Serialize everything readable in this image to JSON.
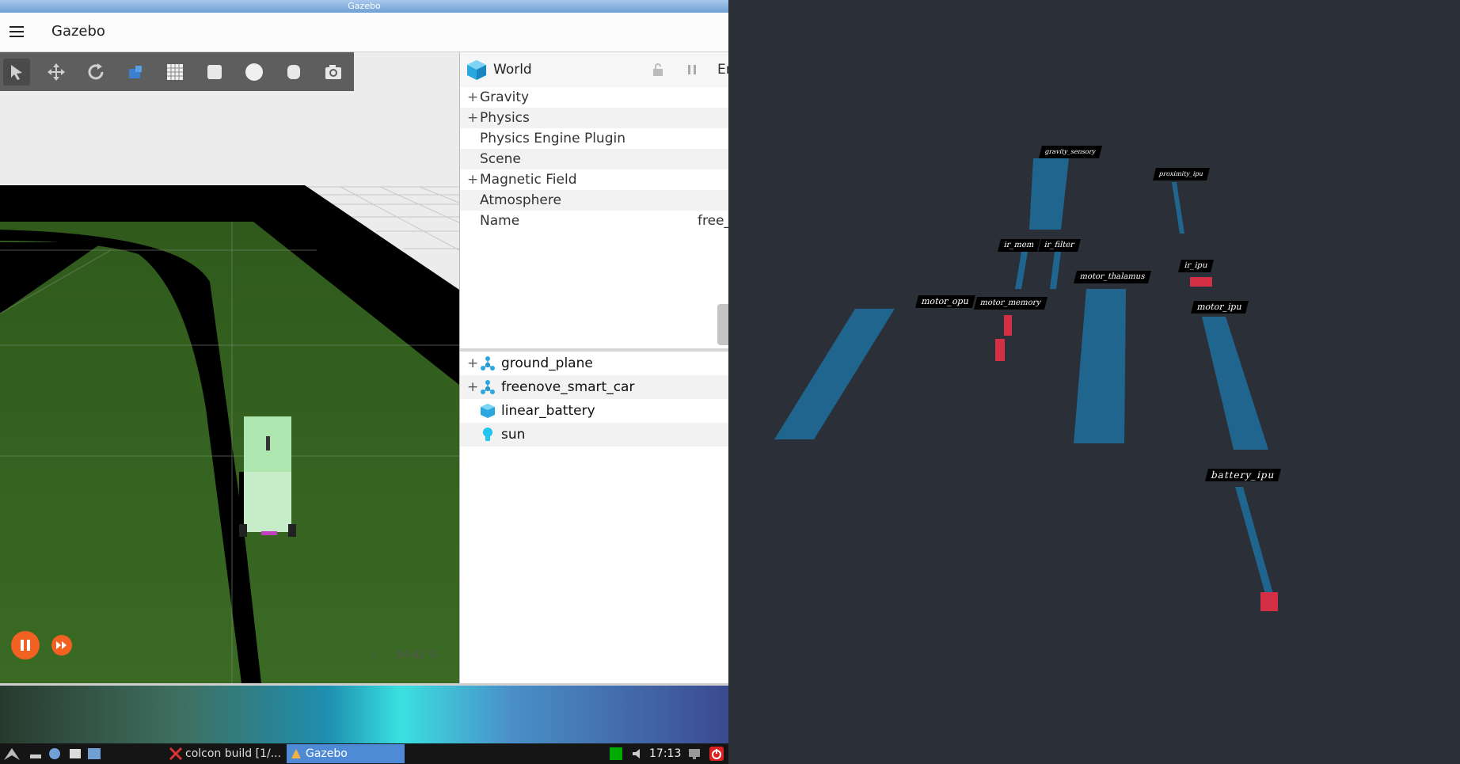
{
  "window": {
    "title": "Gazebo"
  },
  "appbar": {
    "title": "Gazebo"
  },
  "toolbar": {
    "tools": [
      "select-icon",
      "translate-icon",
      "rotate-icon",
      "scale-icon",
      "grid-icon",
      "box-icon",
      "sphere-icon",
      "cylinder-icon",
      "camera-icon"
    ]
  },
  "world_panel": {
    "title": "World",
    "header_extra": "Er",
    "properties": [
      {
        "label": "Gravity",
        "expandable": true
      },
      {
        "label": "Physics",
        "expandable": true
      },
      {
        "label": "Physics Engine Plugin",
        "expandable": false
      },
      {
        "label": "Scene",
        "expandable": false
      },
      {
        "label": "Magnetic Field",
        "expandable": true
      },
      {
        "label": "Atmosphere",
        "expandable": false
      },
      {
        "label": "Name",
        "expandable": false,
        "value": "free_"
      }
    ],
    "models": [
      {
        "label": "ground_plane",
        "expandable": true,
        "icon": "model-icon"
      },
      {
        "label": "freenove_smart_car",
        "expandable": true,
        "icon": "model-icon"
      },
      {
        "label": "linear_battery",
        "expandable": false,
        "icon": "cube-icon"
      },
      {
        "label": "sun",
        "expandable": false,
        "icon": "light-icon"
      }
    ]
  },
  "sim_controls": {
    "real_time_factor": "54.62 %"
  },
  "taskbar": {
    "items": [
      "colcon build [1/...",
      "Gazebo"
    ],
    "clock": "17:13"
  },
  "visualization": {
    "labels": [
      "gravity_sensory",
      "proximity_ipu",
      "ir_mem",
      "ir_filter",
      "motor_thalamus",
      "ir_ipu",
      "motor_opu",
      "motor_memory",
      "motor_ipu",
      "battery_ipu"
    ]
  },
  "colors": {
    "accent_orange": "#f26022",
    "column_blue": "#1f6f9e",
    "block_red": "#d32f45",
    "background_dark": "#2b3038"
  }
}
